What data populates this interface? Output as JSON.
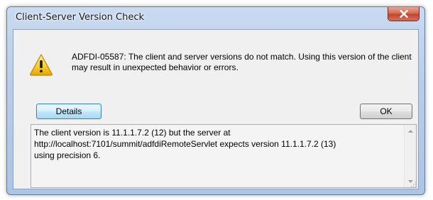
{
  "window": {
    "title": "Client-Server Version Check"
  },
  "message": {
    "text": "ADFDI-05587: The client and server versions do not match. Using this version of the client may result in unexpected behavior or errors."
  },
  "buttons": {
    "details_label": "Details",
    "ok_label": "OK"
  },
  "details": {
    "text": "The client version is 11.1.1.7.2 (12) but the server at\nhttp://localhost:7101/summit/adfdiRemoteServlet expects version 11.1.1.7.2 (13)\nusing precision 6."
  },
  "icons": {
    "close": "close-icon",
    "warning": "warning-icon",
    "scroll_up": "chevron-up-icon",
    "scroll_down": "chevron-down-icon"
  },
  "colors": {
    "close_button": "#c2442c",
    "titlebar": "#b9cde8",
    "warning_yellow": "#f5c400"
  }
}
